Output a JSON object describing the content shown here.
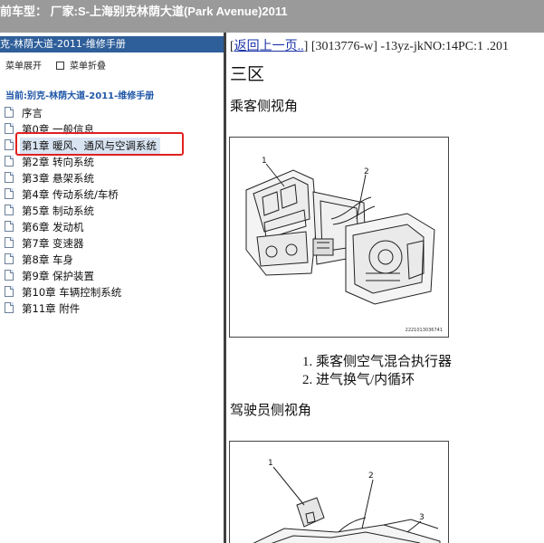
{
  "header": {
    "title": "前车型： 厂家:S-上海别克林荫大道(Park Avenue)2011"
  },
  "sidebar": {
    "title": "克-林荫大道-2011-维修手册",
    "expand_label": "菜单展开",
    "collapse_label": "菜单折叠",
    "current_label": "当前:别克-林荫大道-2011-维修手册",
    "items": [
      {
        "label": "序言"
      },
      {
        "label": "第0章 一般信息"
      },
      {
        "label": "第1章 暖风、通风与空调系统"
      },
      {
        "label": "第2章 转向系统"
      },
      {
        "label": "第3章 悬架系统"
      },
      {
        "label": "第4章 传动系统/车桥"
      },
      {
        "label": "第5章 制动系统"
      },
      {
        "label": "第6章 发动机"
      },
      {
        "label": "第7章 变速器"
      },
      {
        "label": "第8章 车身"
      },
      {
        "label": "第9章 保护装置"
      },
      {
        "label": "第10章 车辆控制系统"
      },
      {
        "label": "第11章 附件"
      }
    ],
    "selected_index": 2
  },
  "content": {
    "bracket_open": "[",
    "back_link": "返回上一页..",
    "id_text": "] [3013776-w] -13yz-jkNO:14PC:1 .201",
    "area_heading": "三区",
    "section1_title": "乘客侧视角",
    "figure1": {
      "code": "2221013036741",
      "callouts": [
        "1",
        "2"
      ]
    },
    "list_items": [
      "1. 乘客侧空气混合执行器",
      "2. 进气换气/内循环"
    ],
    "section2_title": "驾驶员侧视角",
    "figure2": {
      "callouts": [
        "1",
        "2",
        "3"
      ]
    }
  }
}
